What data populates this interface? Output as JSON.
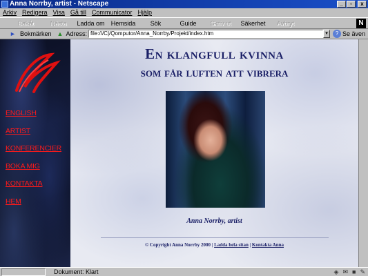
{
  "window": {
    "title": "Anna Norrby, artist - Netscape",
    "buttons": [
      "_",
      "▫",
      "x"
    ]
  },
  "menu": [
    "Arkiv",
    "Redigera",
    "Visa",
    "Gå till",
    "Communicator",
    "Hjälp"
  ],
  "toolbar": {
    "buttons": [
      {
        "label": "Bakåt",
        "enabled": false
      },
      {
        "label": "Nästa",
        "enabled": false
      },
      {
        "label": "Ladda om",
        "enabled": true
      },
      {
        "label": "Hemsida",
        "enabled": true
      },
      {
        "label": "Sök",
        "enabled": true
      },
      {
        "label": "Guide",
        "enabled": true
      },
      {
        "label": "Skriv ut",
        "enabled": false
      },
      {
        "label": "Säkerhet",
        "enabled": true
      },
      {
        "label": "Avbryt",
        "enabled": false
      }
    ],
    "logo_letter": "N"
  },
  "location": {
    "bookmarks_label": "Bokmärken",
    "address_label": "Adress:",
    "address_value": "file:///C|/Qomputor/Anna_Norrby/Projekt/index.htm",
    "related_label": "Se även"
  },
  "page": {
    "heading_line1": "En klangfull kvinna",
    "heading_line2": "som får luften att vibrera",
    "nav": [
      "ENGLISH",
      "ARTIST",
      "KONFERENCIER",
      "BOKA MIG",
      "KONTAKTA",
      "HEM"
    ],
    "caption": "Anna Norrby, artist",
    "footer": {
      "copyright": "© Copyright Anna Norrby 2000 |",
      "link1": "Ladda hela sitan",
      "separator": "|",
      "link2": "Kontakta Anna"
    }
  },
  "status": {
    "text": "Dokument: Klart"
  },
  "colors": {
    "nav_link": "#ff1a1a",
    "heading": "#1a1f66",
    "titlebar": "#0a2a88"
  }
}
